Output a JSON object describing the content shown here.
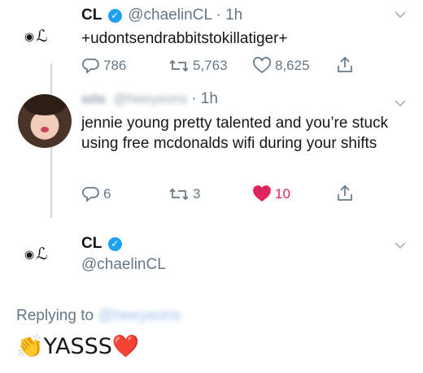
{
  "tweet1": {
    "author_logo": "CL",
    "name": "CL",
    "verified_icon": "verified-badge-icon",
    "handle": "@chaelinCL",
    "time": "· 1h",
    "text": "+udontsendrabbitstokillatiger+",
    "replies": "786",
    "retweets": "5,763",
    "likes": "8,625"
  },
  "tweet2": {
    "name": "ada",
    "handle": "@heeyeons",
    "time": "· 1h",
    "text": "jennie young pretty talented and you’re stuck using free mcdonalds wifi during your shifts",
    "replies": "6",
    "retweets": "3",
    "likes": "10",
    "liked_color": "#e0245e"
  },
  "tweet3": {
    "author_logo": "CL",
    "name": "CL",
    "handle": "@chaelinCL",
    "replying_label": "Replying to",
    "replying_handle": "@heeyeons",
    "text": "👏YASSS❤️"
  },
  "colors": {
    "accent": "#1da1f2",
    "muted": "#657786",
    "like": "#e0245e"
  }
}
